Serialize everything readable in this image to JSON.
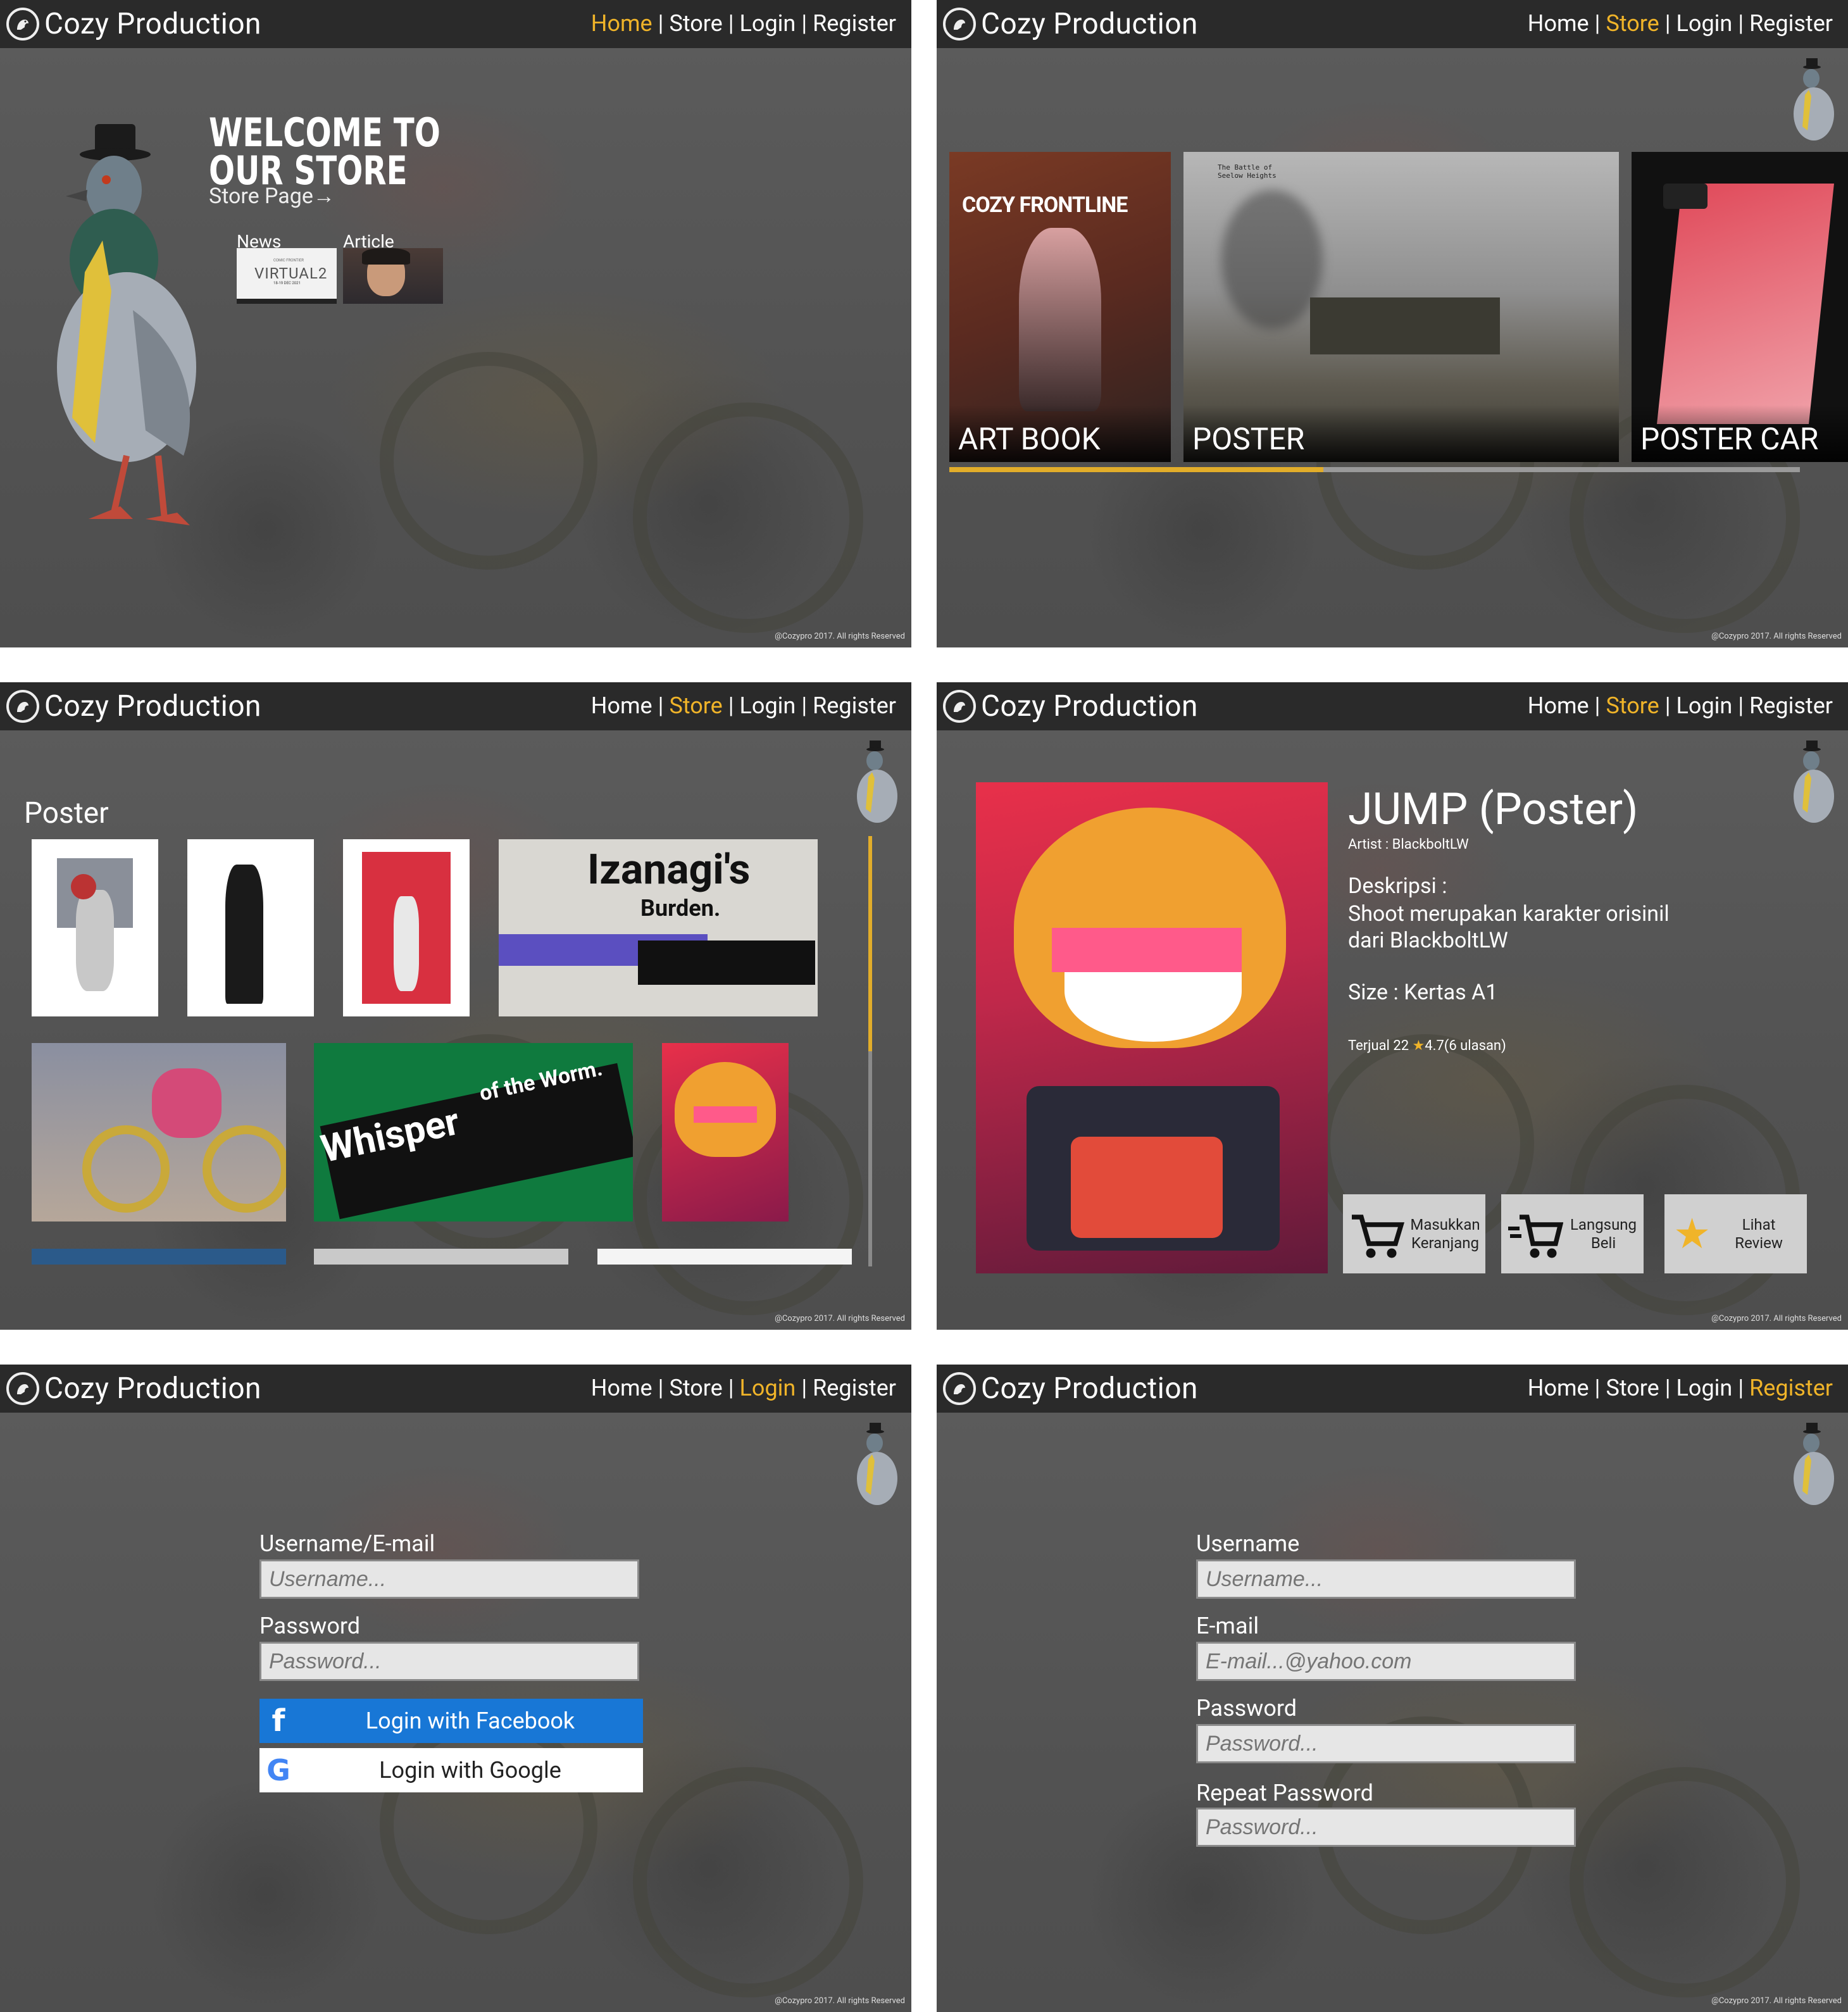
{
  "brand": {
    "title": "Cozy Production"
  },
  "nav": {
    "home": "Home",
    "store": "Store",
    "login": "Login",
    "register": "Register"
  },
  "footer": "@Cozypro 2017. All rights Reserved",
  "home": {
    "headline_line1": "WELCOME TO",
    "headline_line2": "OUR STORE",
    "store_link": "Store Page",
    "news_label": "News",
    "article_label": "Article",
    "news_thumb_text": "VIRTUAL2",
    "news_thumb_small": "COMIC FRONTIER",
    "news_thumb_date": "18-19 DEC 2021"
  },
  "store": {
    "categories": [
      {
        "label": "ART BOOK",
        "cover_text": "COZY FRONTLINE"
      },
      {
        "label": "POSTER",
        "cover_text": "The Battle of Seelow Heights"
      },
      {
        "label": "POSTER CAR"
      }
    ],
    "scroll_progress": 0.44
  },
  "poster_list": {
    "heading": "Poster",
    "thumb_izanagi_1": "Izanagi's",
    "thumb_izanagi_2": "Burden.",
    "thumb_whisper_1": "Whisper",
    "thumb_whisper_2": "of the Worm."
  },
  "product": {
    "title": "JUMP (Poster)",
    "artist": "Artist : BlackboltLW",
    "desc_label": "Deskripsi :",
    "desc_line1": "Shoot merupakan karakter orisinil",
    "desc_line2": "dari BlackboltLW",
    "size": "Size : Kertas A1",
    "sold": "Terjual 22",
    "rating": "4.7(6 ulasan)",
    "btn_cart_1": "Masukkan",
    "btn_cart_2": "Keranjang",
    "btn_buy_1": "Langsung",
    "btn_buy_2": "Beli",
    "btn_review_1": "Lihat",
    "btn_review_2": "Review",
    "accent": "#f0b429"
  },
  "login": {
    "user_label": "Username/E-mail",
    "user_placeholder": "Username...",
    "pass_label": "Password",
    "pass_placeholder": "Password...",
    "facebook": "Login with Facebook",
    "google": "Login with Google"
  },
  "register": {
    "user_label": "Username",
    "user_placeholder": "Username...",
    "email_label": "E-mail",
    "email_placeholder": "E-mail...@yahoo.com",
    "pass_label": "Password",
    "pass_placeholder": "Password...",
    "repeat_label": "Repeat Password",
    "repeat_placeholder": "Password..."
  },
  "colors": {
    "accent": "#f0b429",
    "header": "#2a2a2a",
    "facebook": "#1877d6"
  },
  "icons": [
    "pigeon-logo-icon",
    "arrow-right-icon",
    "cart-icon",
    "fast-cart-icon",
    "star-icon",
    "facebook-icon",
    "google-icon"
  ]
}
